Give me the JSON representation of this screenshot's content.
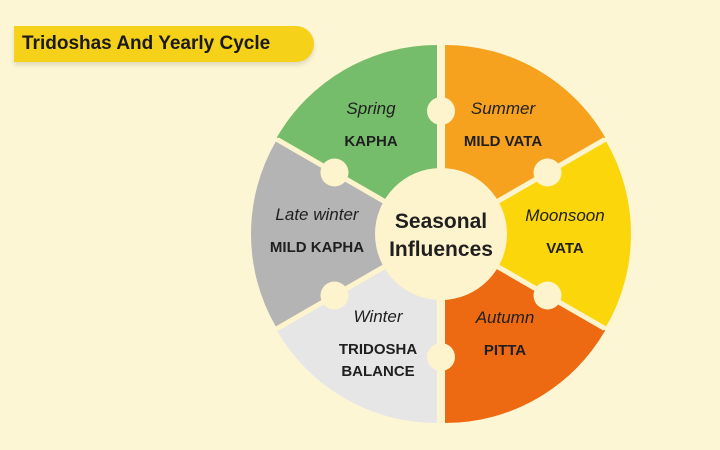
{
  "title": "Tridoshas And Yearly Cycle",
  "center": {
    "line1": "Seasonal",
    "line2": "Influences"
  },
  "segments": [
    {
      "id": "summer",
      "season": "Summer",
      "dosha_lines": [
        "MILD VATA"
      ],
      "color": "#f6a21e"
    },
    {
      "id": "monsoon",
      "season": "Moonsoon",
      "dosha_lines": [
        "VATA"
      ],
      "color": "#fbd60a"
    },
    {
      "id": "autumn",
      "season": "Autumn",
      "dosha_lines": [
        "PITTA"
      ],
      "color": "#ee6a12"
    },
    {
      "id": "winter",
      "season": "Winter",
      "dosha_lines": [
        "TRIDOSHA",
        "BALANCE"
      ],
      "color": "#e6e6e6"
    },
    {
      "id": "late-winter",
      "season": "Late winter",
      "dosha_lines": [
        "MILD KAPHA"
      ],
      "color": "#b4b4b4"
    },
    {
      "id": "spring",
      "season": "Spring",
      "dosha_lines": [
        "KAPHA"
      ],
      "color": "#76bd6b"
    }
  ],
  "colors": {
    "background": "#fdf6d4",
    "accent": "#f6d11a",
    "divider": "#fdf3cc"
  }
}
